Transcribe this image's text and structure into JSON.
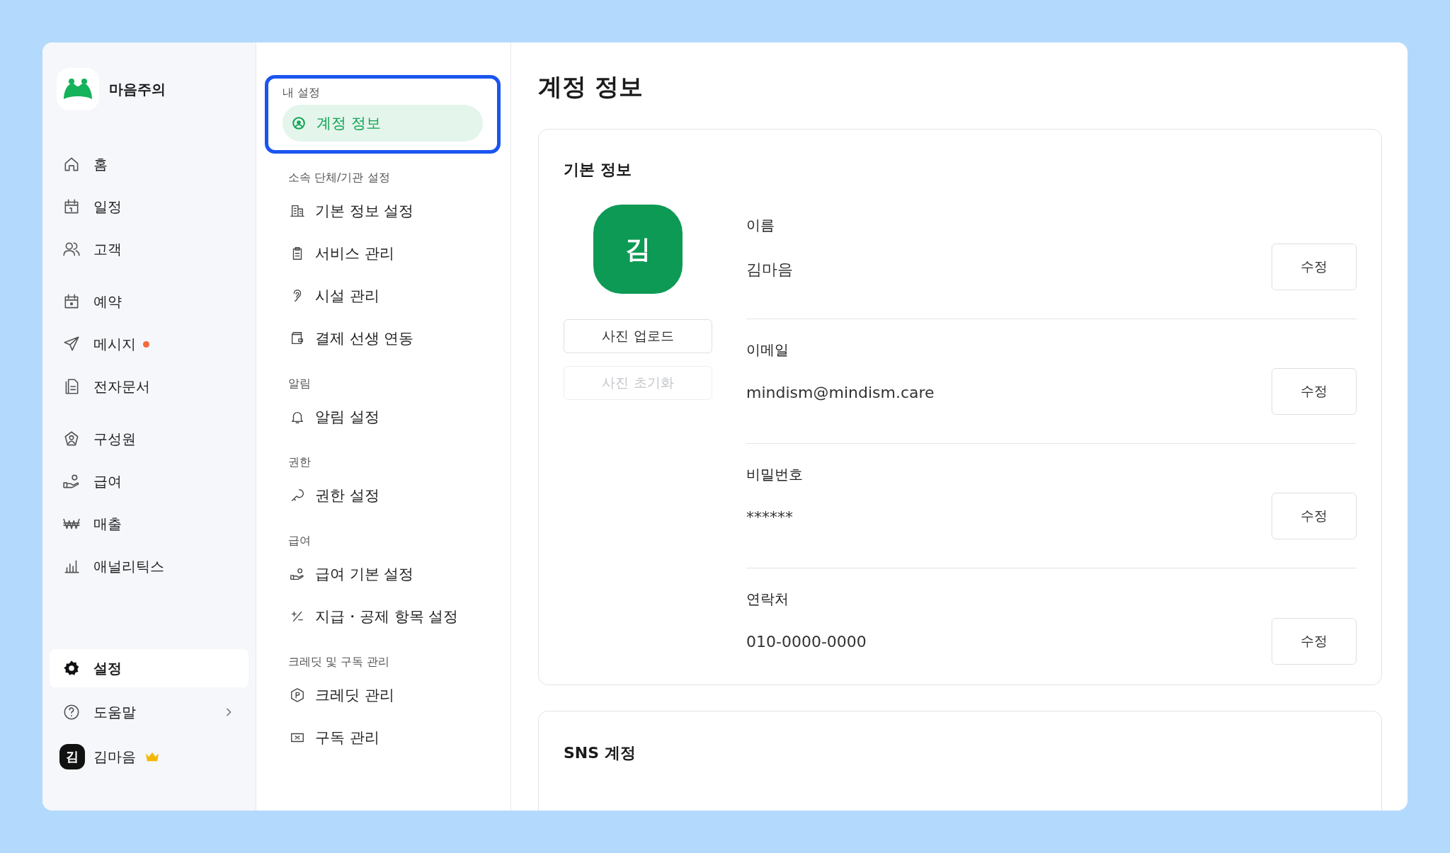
{
  "app": {
    "name": "마음주의"
  },
  "sidebar": {
    "groups": [
      {
        "items": [
          {
            "label": "홈",
            "selected": false,
            "notification": false
          },
          {
            "label": "일정",
            "selected": false,
            "notification": false
          },
          {
            "label": "고객",
            "selected": false,
            "notification": false
          }
        ]
      },
      {
        "items": [
          {
            "label": "예약",
            "selected": false,
            "notification": false
          },
          {
            "label": "메시지",
            "selected": false,
            "notification": true
          },
          {
            "label": "전자문서",
            "selected": false,
            "notification": false
          }
        ]
      },
      {
        "items": [
          {
            "label": "구성원",
            "selected": false,
            "notification": false
          },
          {
            "label": "급여",
            "selected": false,
            "notification": false
          },
          {
            "label": "매출",
            "selected": false,
            "notification": false
          },
          {
            "label": "애널리틱스",
            "selected": false,
            "notification": false
          }
        ]
      }
    ],
    "bottom_items": [
      {
        "label": "설정",
        "selected": true,
        "has_submenu": false
      },
      {
        "label": "도움말",
        "selected": false,
        "has_submenu": true
      }
    ],
    "user": {
      "initial": "김",
      "name": "김마음",
      "owner": true
    }
  },
  "settings_menu": {
    "sections": [
      {
        "heading": "내 설정",
        "highlighted": true,
        "items": [
          {
            "label": "계정 정보",
            "selected": true
          }
        ]
      },
      {
        "heading": "소속 단체/기관 설정",
        "highlighted": false,
        "items": [
          {
            "label": "기본 정보 설정",
            "selected": false
          },
          {
            "label": "서비스 관리",
            "selected": false
          },
          {
            "label": "시설 관리",
            "selected": false
          },
          {
            "label": "결제 선생 연동",
            "selected": false
          }
        ]
      },
      {
        "heading": "알림",
        "highlighted": false,
        "items": [
          {
            "label": "알림 설정",
            "selected": false
          }
        ]
      },
      {
        "heading": "권한",
        "highlighted": false,
        "items": [
          {
            "label": "권한 설정",
            "selected": false
          }
        ]
      },
      {
        "heading": "급여",
        "highlighted": false,
        "items": [
          {
            "label": "급여 기본 설정",
            "selected": false
          },
          {
            "label": "지급・공제 항목 설정",
            "selected": false
          }
        ]
      },
      {
        "heading": "크레딧 및 구독 관리",
        "highlighted": false,
        "items": [
          {
            "label": "크레딧 관리",
            "selected": false
          },
          {
            "label": "구독 관리",
            "selected": false
          }
        ]
      }
    ]
  },
  "main": {
    "title": "계정 정보",
    "profile_card": {
      "title": "기본 정보",
      "avatar_initial": "김",
      "photo_buttons": [
        {
          "label": "사진 업로드",
          "disabled": false
        },
        {
          "label": "사진 초기화",
          "disabled": true
        }
      ],
      "fields": [
        {
          "label": "이름",
          "value": "김마음",
          "button": "수정"
        },
        {
          "label": "이메일",
          "value": "mindism@mindism.care",
          "button": "수정"
        },
        {
          "label": "비밀번호",
          "value": "******",
          "button": "수정"
        },
        {
          "label": "연락처",
          "value": "010-0000-0000",
          "button": "수정"
        }
      ]
    },
    "sns_card": {
      "title": "SNS 계정"
    }
  }
}
